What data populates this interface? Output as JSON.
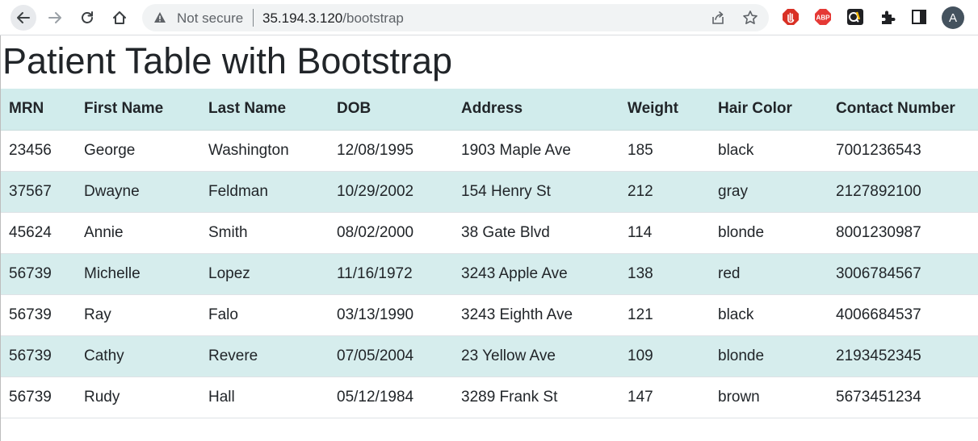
{
  "browser": {
    "security_label": "Not secure",
    "url_host": "35.194.3.120",
    "url_path": "/bootstrap",
    "extensions": [
      "stop-extension",
      "adblock-plus",
      "qa-extension",
      "extensions-puzzle"
    ],
    "avatar_letter": "A"
  },
  "page": {
    "title": "Patient Table with Bootstrap"
  },
  "table": {
    "headers": [
      "MRN",
      "First Name",
      "Last Name",
      "DOB",
      "Address",
      "Weight",
      "Hair Color",
      "Contact Number"
    ],
    "rows": [
      [
        "23456",
        "George",
        "Washington",
        "12/08/1995",
        "1903 Maple Ave",
        "185",
        "black",
        "7001236543"
      ],
      [
        "37567",
        "Dwayne",
        "Feldman",
        "10/29/2002",
        "154 Henry St",
        "212",
        "gray",
        "2127892100"
      ],
      [
        "45624",
        "Annie",
        "Smith",
        "08/02/2000",
        "38 Gate Blvd",
        "114",
        "blonde",
        "8001230987"
      ],
      [
        "56739",
        "Michelle",
        "Lopez",
        "11/16/1972",
        "3243 Apple Ave",
        "138",
        "red",
        "3006784567"
      ],
      [
        "56739",
        "Ray",
        "Falo",
        "03/13/1990",
        "3243 Eighth Ave",
        "121",
        "black",
        "4006684537"
      ],
      [
        "56739",
        "Cathy",
        "Revere",
        "07/05/2004",
        "23 Yellow Ave",
        "109",
        "blonde",
        "2193452345"
      ],
      [
        "56739",
        "Rudy",
        "Hall",
        "05/12/1984",
        "3289 Frank St",
        "147",
        "brown",
        "5673451234"
      ]
    ]
  },
  "colors": {
    "header_bg": "#d1ecec",
    "stripe_bg": "#d6eded"
  }
}
